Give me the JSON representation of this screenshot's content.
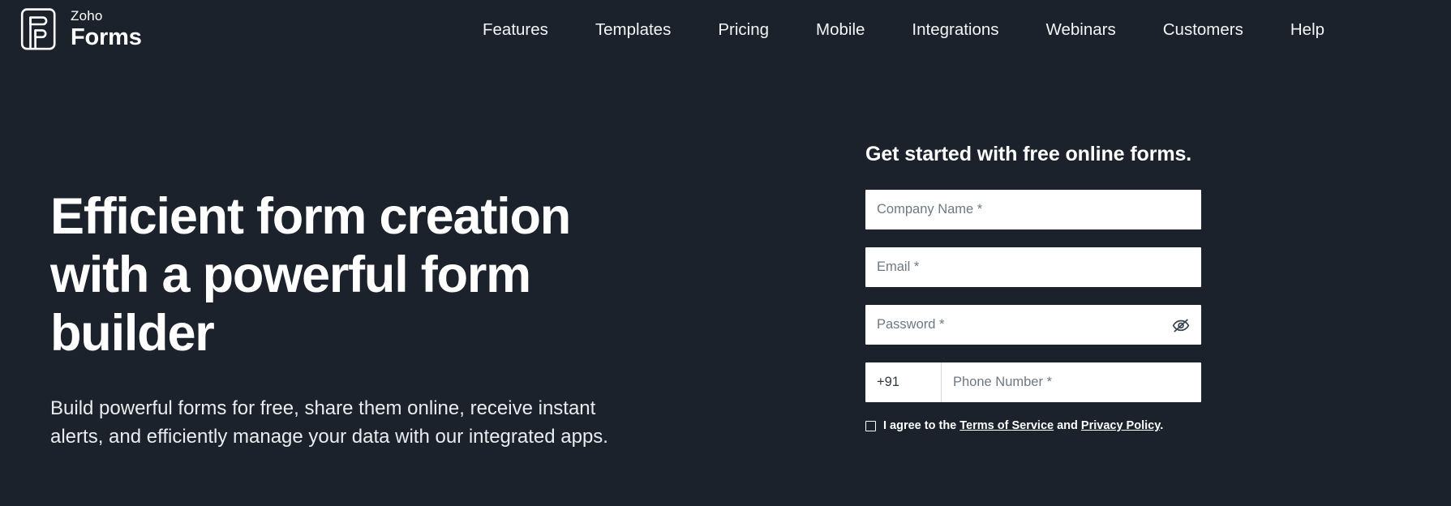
{
  "theme": {
    "background": "#1b222b",
    "text_primary": "#ffffff",
    "field_background": "#ffffff",
    "placeholder": "#6e7882"
  },
  "header": {
    "brand": {
      "icon": "zoho-forms-logo-icon",
      "company": "Zoho",
      "product": "Forms"
    },
    "nav": [
      {
        "label": "Features"
      },
      {
        "label": "Templates"
      },
      {
        "label": "Pricing"
      },
      {
        "label": "Mobile"
      },
      {
        "label": "Integrations"
      },
      {
        "label": "Webinars"
      },
      {
        "label": "Customers"
      },
      {
        "label": "Help"
      }
    ]
  },
  "hero": {
    "title": "Efficient form creation with a powerful form builder",
    "subtitle": "Build powerful forms for free, share them online, receive instant alerts, and efficiently manage your data with our integrated apps."
  },
  "signup": {
    "heading": "Get started with free online forms.",
    "fields": {
      "company": {
        "placeholder": "Company Name *",
        "value": ""
      },
      "email": {
        "placeholder": "Email *",
        "value": ""
      },
      "password": {
        "placeholder": "Password *",
        "value": "",
        "toggle_icon": "eye-off-icon"
      },
      "phone": {
        "country_code": "+91",
        "placeholder": "Phone Number *",
        "value": ""
      }
    },
    "terms": {
      "checked": false,
      "prefix": "I agree to the ",
      "terms_link": "Terms of Service",
      "conjunction": " and ",
      "privacy_link": "Privacy Policy",
      "suffix": "."
    }
  }
}
